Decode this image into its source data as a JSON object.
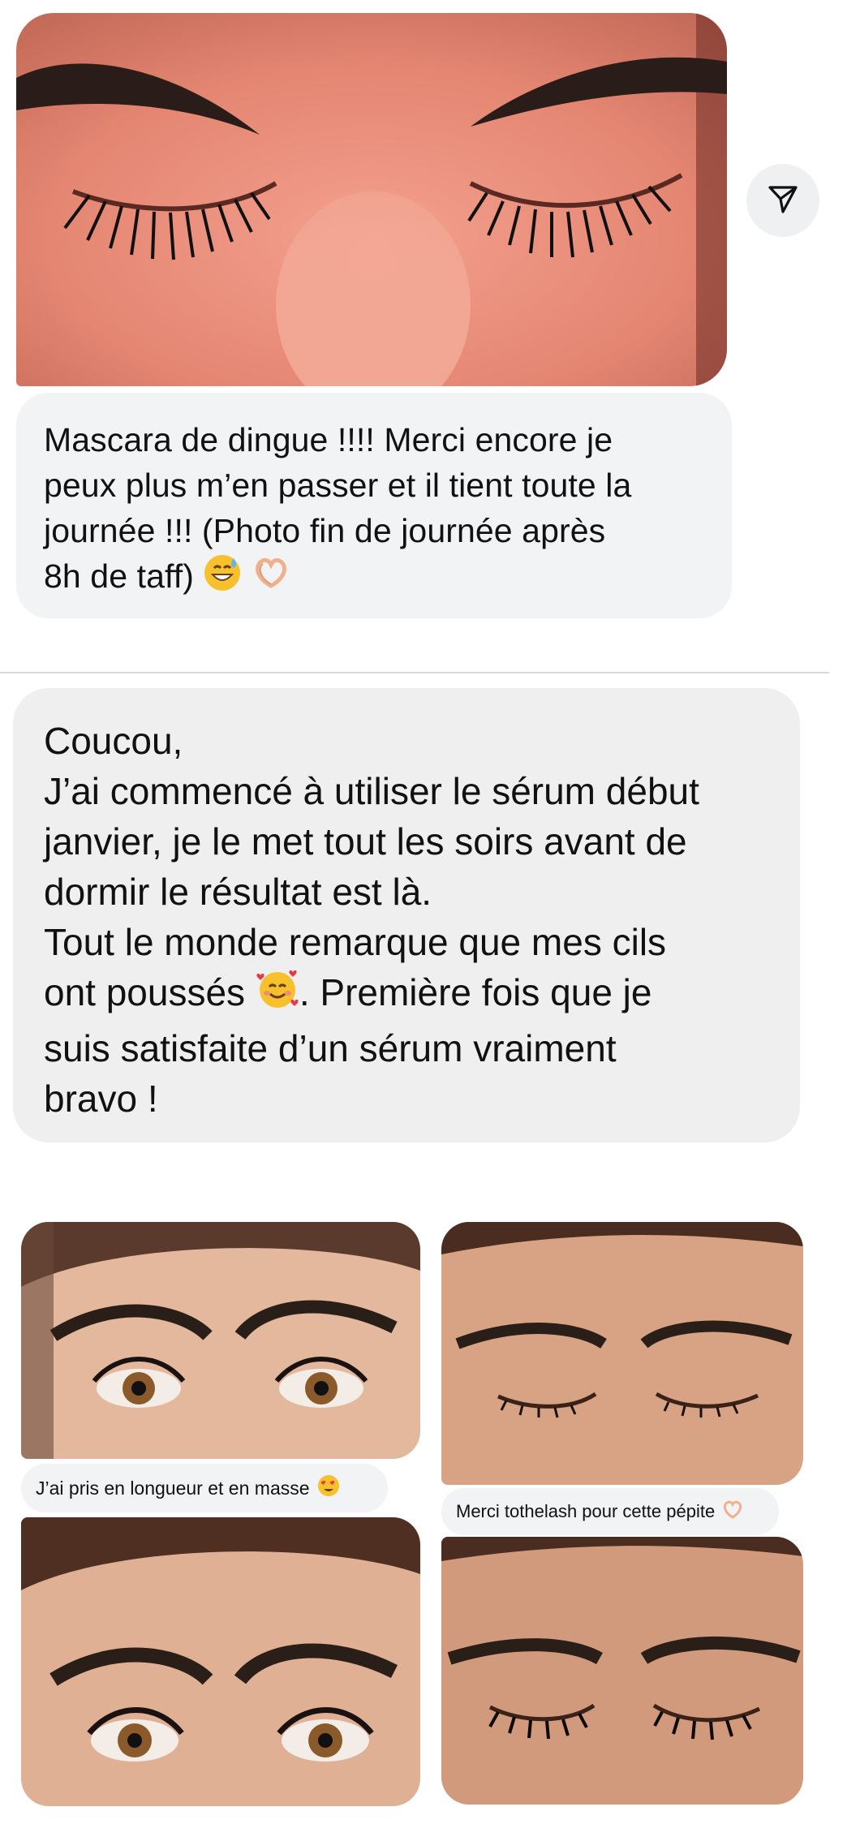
{
  "message1": {
    "lines": [
      "Mascara de dingue !!!! Merci encore je",
      "peux plus m’en passer et il tient toute la",
      "journée !!! (Photo fin de journée après",
      "8h de taff)"
    ],
    "emoji_icons": [
      "grinning-sweat-emoji",
      "heart-hands-emoji"
    ]
  },
  "message2": {
    "lines": [
      "Coucou,",
      "J’ai commencé à utiliser le sérum début",
      "janvier, je le met tout les soirs avant de",
      "dormir le résultat est là.",
      "Tout le monde remarque que mes cils",
      "ont poussés",
      ". Première fois que je",
      "suis satisfaite d’un sérum vraiment",
      "bravo !"
    ],
    "emoji_icons": [
      "smiling-face-with-hearts-emoji"
    ]
  },
  "captions": {
    "left": "J’ai pris en longueur et en masse",
    "right": "Merci tothelash pour cette pépite"
  },
  "icons": {
    "share": "paper-plane-icon"
  },
  "colors": {
    "bubble": "#f2f3f5",
    "bubble_alt": "#efefef",
    "text": "#111111"
  }
}
